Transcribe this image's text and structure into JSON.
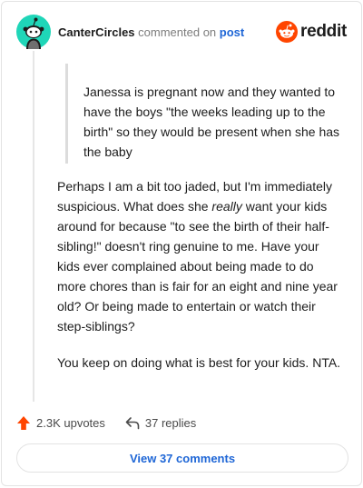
{
  "header": {
    "username": "CanterCircles",
    "action_text": "commented on",
    "post_link": "post",
    "brand": "reddit"
  },
  "quote": {
    "text": "Janessa is pregnant now and they wanted to have the boys \"the weeks leading up to the birth\" so they would be present when she has the baby"
  },
  "comment": {
    "p1_before": "Perhaps I am a bit too jaded, but I'm immediately suspicious. What does she ",
    "p1_emphasis": "really",
    "p1_after": " want your kids around for because \"to see the birth of their half-sibling!\" doesn't ring genuine to me. Have your kids ever complained about being made to do more chores than is fair for an eight and nine year old? Or being made to entertain or watch their step-siblings?",
    "p2": "You keep on doing what is best for your kids. NTA."
  },
  "actions": {
    "upvotes": "2.3K upvotes",
    "replies": "37 replies"
  },
  "view_button": "View 37 comments",
  "colors": {
    "avatar_bg": "#1fd6b8",
    "reddit_orange": "#ff4500",
    "link_blue": "#1e66d6"
  },
  "icons": {
    "avatar": "snoo-avatar-icon",
    "brand": "reddit-logo-icon",
    "upvote": "upvote-arrow-icon",
    "reply": "reply-arrow-icon"
  }
}
